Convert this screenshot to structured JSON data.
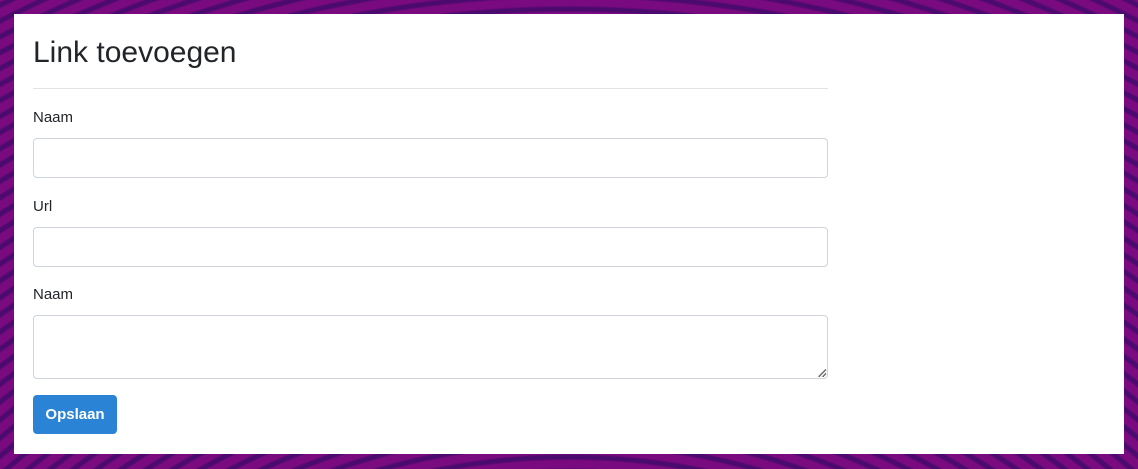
{
  "form": {
    "title": "Link toevoegen",
    "fields": [
      {
        "label": "Naam",
        "value": "",
        "placeholder": ""
      },
      {
        "label": "Url",
        "value": "",
        "placeholder": ""
      },
      {
        "label": "Naam",
        "value": "",
        "placeholder": ""
      }
    ],
    "submit_label": "Opslaan"
  },
  "colors": {
    "accent": "#2a83d5",
    "background_purple": "#7a0a80",
    "background_dark": "#4a0a6e"
  }
}
